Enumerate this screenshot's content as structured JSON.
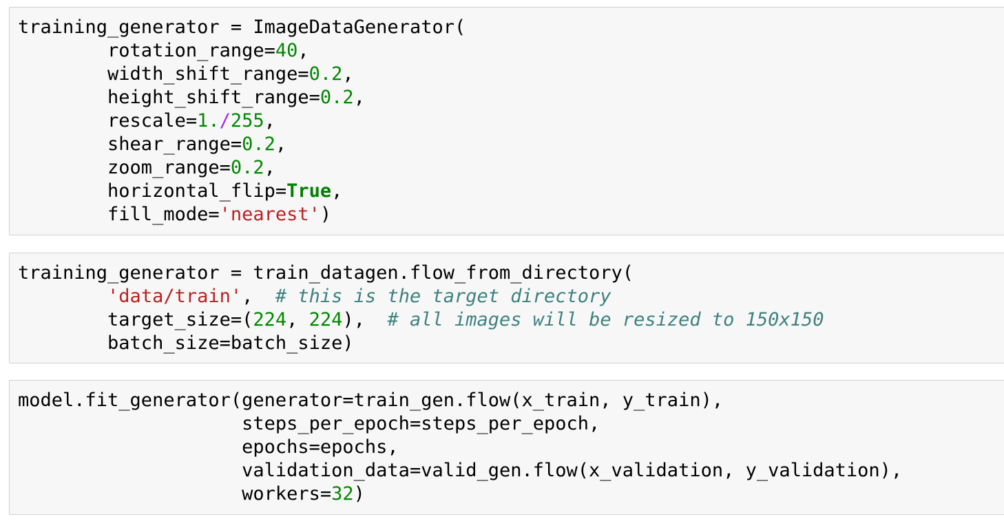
{
  "colors": {
    "number": "#008800",
    "operator": "#aa22ff",
    "string": "#ba2121",
    "keyword": "#008000",
    "comment": "#408080",
    "cell_background": "#f7f7f7",
    "cell_border": "#cfcfcf"
  },
  "cells": [
    {
      "lines": [
        [
          {
            "t": "p",
            "v": "training_generator = ImageDataGenerator("
          }
        ],
        [
          {
            "t": "p",
            "v": "        rotation_range="
          },
          {
            "t": "num",
            "v": "40"
          },
          {
            "t": "p",
            "v": ","
          }
        ],
        [
          {
            "t": "p",
            "v": "        width_shift_range="
          },
          {
            "t": "num",
            "v": "0.2"
          },
          {
            "t": "p",
            "v": ","
          }
        ],
        [
          {
            "t": "p",
            "v": "        height_shift_range="
          },
          {
            "t": "num",
            "v": "0.2"
          },
          {
            "t": "p",
            "v": ","
          }
        ],
        [
          {
            "t": "p",
            "v": "        rescale="
          },
          {
            "t": "num",
            "v": "1."
          },
          {
            "t": "op",
            "v": "/"
          },
          {
            "t": "num",
            "v": "255"
          },
          {
            "t": "p",
            "v": ","
          }
        ],
        [
          {
            "t": "p",
            "v": "        shear_range="
          },
          {
            "t": "num",
            "v": "0.2"
          },
          {
            "t": "p",
            "v": ","
          }
        ],
        [
          {
            "t": "p",
            "v": "        zoom_range="
          },
          {
            "t": "num",
            "v": "0.2"
          },
          {
            "t": "p",
            "v": ","
          }
        ],
        [
          {
            "t": "p",
            "v": "        horizontal_flip="
          },
          {
            "t": "kw",
            "v": "True"
          },
          {
            "t": "p",
            "v": ","
          }
        ],
        [
          {
            "t": "p",
            "v": "        fill_mode="
          },
          {
            "t": "str",
            "v": "'nearest'"
          },
          {
            "t": "p",
            "v": ")"
          }
        ]
      ]
    },
    {
      "lines": [
        [
          {
            "t": "p",
            "v": "training_generator = train_datagen.flow_from_directory("
          }
        ],
        [
          {
            "t": "p",
            "v": "        "
          },
          {
            "t": "str",
            "v": "'data/train'"
          },
          {
            "t": "p",
            "v": ",  "
          },
          {
            "t": "cmt",
            "v": "# this is the target directory"
          }
        ],
        [
          {
            "t": "p",
            "v": "        target_size=("
          },
          {
            "t": "num",
            "v": "224"
          },
          {
            "t": "p",
            "v": ", "
          },
          {
            "t": "num",
            "v": "224"
          },
          {
            "t": "p",
            "v": "),  "
          },
          {
            "t": "cmt",
            "v": "# all images will be resized to 150x150"
          }
        ],
        [
          {
            "t": "p",
            "v": "        batch_size=batch_size)"
          }
        ]
      ]
    },
    {
      "lines": [
        [
          {
            "t": "p",
            "v": "model.fit_generator(generator=train_gen.flow(x_train, y_train),"
          }
        ],
        [
          {
            "t": "p",
            "v": "                    steps_per_epoch=steps_per_epoch,"
          }
        ],
        [
          {
            "t": "p",
            "v": "                    epochs=epochs,"
          }
        ],
        [
          {
            "t": "p",
            "v": "                    validation_data=valid_gen.flow(x_validation, y_validation),"
          }
        ],
        [
          {
            "t": "p",
            "v": "                    workers="
          },
          {
            "t": "num",
            "v": "32"
          },
          {
            "t": "p",
            "v": ")"
          }
        ]
      ]
    }
  ]
}
